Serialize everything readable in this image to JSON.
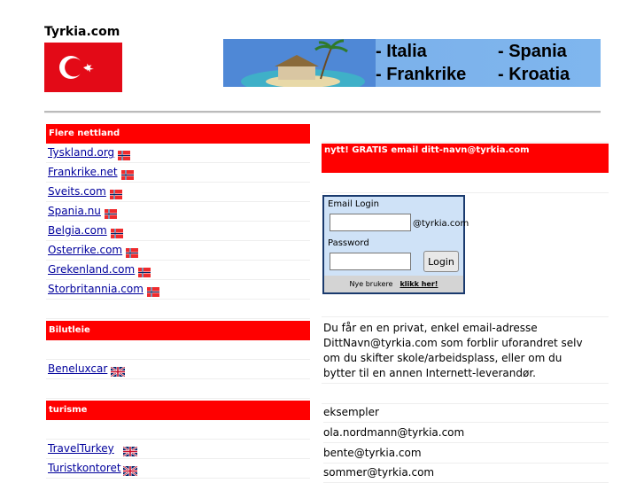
{
  "site": {
    "title": "Tyrkia.com"
  },
  "banner": {
    "destinations": [
      "- Italia",
      "- Spania",
      "- Frankrike",
      "- Kroatia"
    ]
  },
  "left": {
    "sections": [
      {
        "header": "Flere nettland",
        "links": [
          {
            "label": "Tyskland.org",
            "flag": "norway-flag-icon"
          },
          {
            "label": "Frankrike.net",
            "flag": "norway-flag-icon"
          },
          {
            "label": "Sveits.com",
            "flag": "norway-flag-icon"
          },
          {
            "label": "Spania.nu",
            "flag": "norway-flag-icon"
          },
          {
            "label": "Belgia.com",
            "flag": "norway-flag-icon"
          },
          {
            "label": "Osterrike.com",
            "flag": "norway-flag-icon"
          },
          {
            "label": "Grekenland.com",
            "flag": "norway-flag-icon"
          },
          {
            "label": "Storbritannia.com",
            "flag": "norway-flag-icon"
          }
        ]
      },
      {
        "header": "Bilutleie",
        "links": [
          {
            "label": "Beneluxcar",
            "flag": "uk-flag-icon"
          }
        ]
      },
      {
        "header": "turisme",
        "links": [
          {
            "label": "TravelTurkey",
            "flag": "uk-flag-icon"
          },
          {
            "label": "Turistkontoret",
            "flag": "uk-flag-icon"
          }
        ]
      }
    ]
  },
  "right": {
    "promo": "nytt! GRATIS email ditt-navn@tyrkia.com",
    "login": {
      "title": "Email Login",
      "domain_suffix": "@tyrkia.com",
      "password_label": "Password",
      "button": "Login",
      "new_users": "Nye brukere",
      "click_here": "klikk her!"
    },
    "description": "Du får en en privat, enkel email-adresse DittNavn@tyrkia.com som forblir uforandret selv om du skifter skole/arbeidsplass, eller om du bytter til en annen Internett-leverandør.",
    "examples_label": "eksempler",
    "examples": [
      "ola.nordmann@tyrkia.com",
      "bente@tyrkia.com",
      "sommer@tyrkia.com"
    ]
  },
  "colors": {
    "section_header": "#ff0000",
    "link": "#00009c",
    "login_bg": "#cfe2f7"
  }
}
